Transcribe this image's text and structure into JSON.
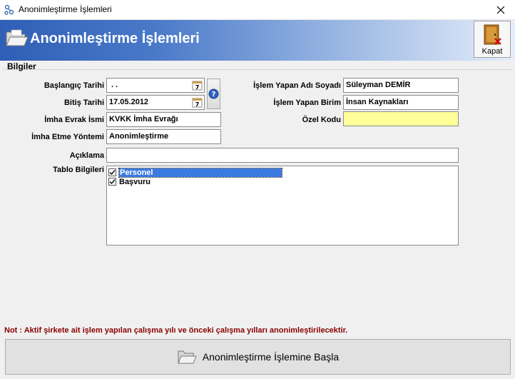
{
  "window": {
    "title": "Anonimleştirme İşlemleri"
  },
  "banner": {
    "title": "Anonimleştirme İşlemleri"
  },
  "toolbar": {
    "close_label": "Kapat"
  },
  "section": {
    "title": "Bilgiler"
  },
  "form": {
    "start_date": {
      "label": "Başlangıç Tarihi",
      "value": " . ."
    },
    "end_date": {
      "label": "Bitiş Tarihi",
      "value": "17.05.2012"
    },
    "doc_name": {
      "label": "İmha Evrak İsmi",
      "value": "KVKK İmha Evrağı"
    },
    "method": {
      "label": "İmha Etme Yöntemi",
      "value": "Anonimleştirme"
    },
    "user": {
      "label": "İşlem Yapan Adı Soyadı",
      "value": "Süleyman DEMİR"
    },
    "unit": {
      "label": "İşlem Yapan Birim",
      "value": "İnsan Kaynakları"
    },
    "special_code": {
      "label": "Özel Kodu",
      "value": ""
    },
    "description": {
      "label": "Açıklama",
      "value": ""
    },
    "tables": {
      "label": "Tablo Bilgileri",
      "items": [
        {
          "label": "Personel",
          "checked": true,
          "selected": true
        },
        {
          "label": "Başvuru",
          "checked": true,
          "selected": false
        }
      ]
    }
  },
  "note": "Not : Aktif şirkete ait işlem yapılan çalışma yılı ve önceki çalışma yılları anonimleştirilecektir.",
  "actions": {
    "start_label": "Anonimleştirme İşlemine Başla"
  },
  "colors": {
    "note": "#8b0000",
    "selection": "#3b7be0",
    "special_code_bg": "#ffff99"
  }
}
